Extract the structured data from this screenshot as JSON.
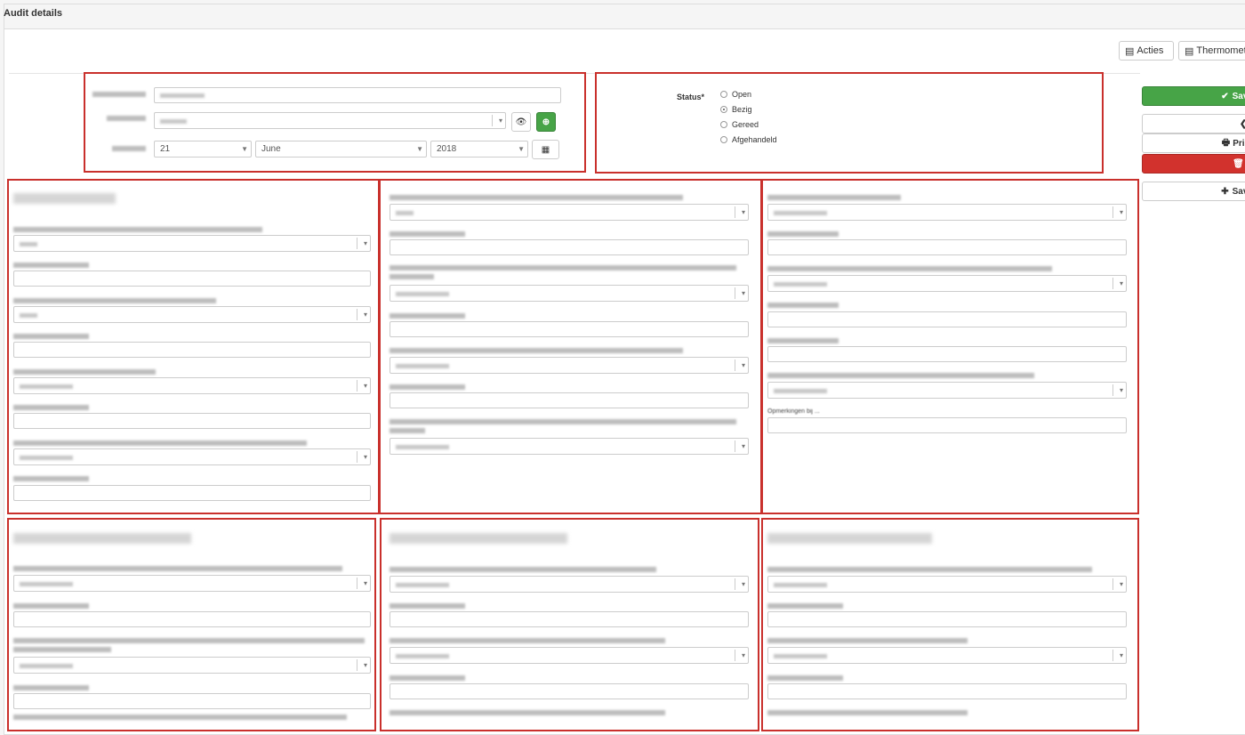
{
  "window": {
    "title": "Audit details"
  },
  "toolbar": {
    "acties_label": "Acties",
    "thermometer_label": "Thermometer"
  },
  "status": {
    "label": "Status*",
    "options": [
      "Open",
      "Bezig",
      "Gereed",
      "Afgehandeld"
    ],
    "selected": "Bezig"
  },
  "date": {
    "day": "21",
    "month": "June",
    "year": "2018"
  },
  "sidebar": {
    "save_label": "Save",
    "back_label": "",
    "print_label": "Print",
    "delete_label": "D",
    "save2_label": "Save"
  },
  "colors": {
    "accent_green": "#47a447",
    "danger_red": "#d2322d",
    "box_red": "#c9302c"
  },
  "sections": {
    "s3_last_label": "Opmerkingen bij ..."
  }
}
